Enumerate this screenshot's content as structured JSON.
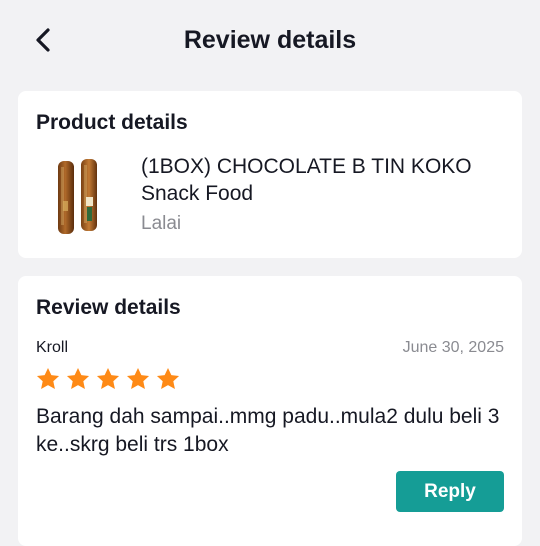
{
  "header": {
    "title": "Review details",
    "back_icon": "chevron-left-icon"
  },
  "product_section": {
    "heading": "Product details",
    "product_name": "(1BOX) CHOCOLATE B TIN KOKO Snack Food",
    "shop_name": "Lalai"
  },
  "review_section": {
    "heading": "Review details",
    "reviewer": "Kroll",
    "date": "June 30, 2025",
    "rating": 5,
    "rating_max": 5,
    "text": "Barang dah sampai..mmg padu..mula2 dulu beli 3 ke..skrg beli trs 1box",
    "reply_label": "Reply"
  },
  "colors": {
    "background": "#f2f2f4",
    "card": "#ffffff",
    "accent": "#159d96",
    "star": "#fe8a16",
    "muted_text": "#8a8b91"
  }
}
